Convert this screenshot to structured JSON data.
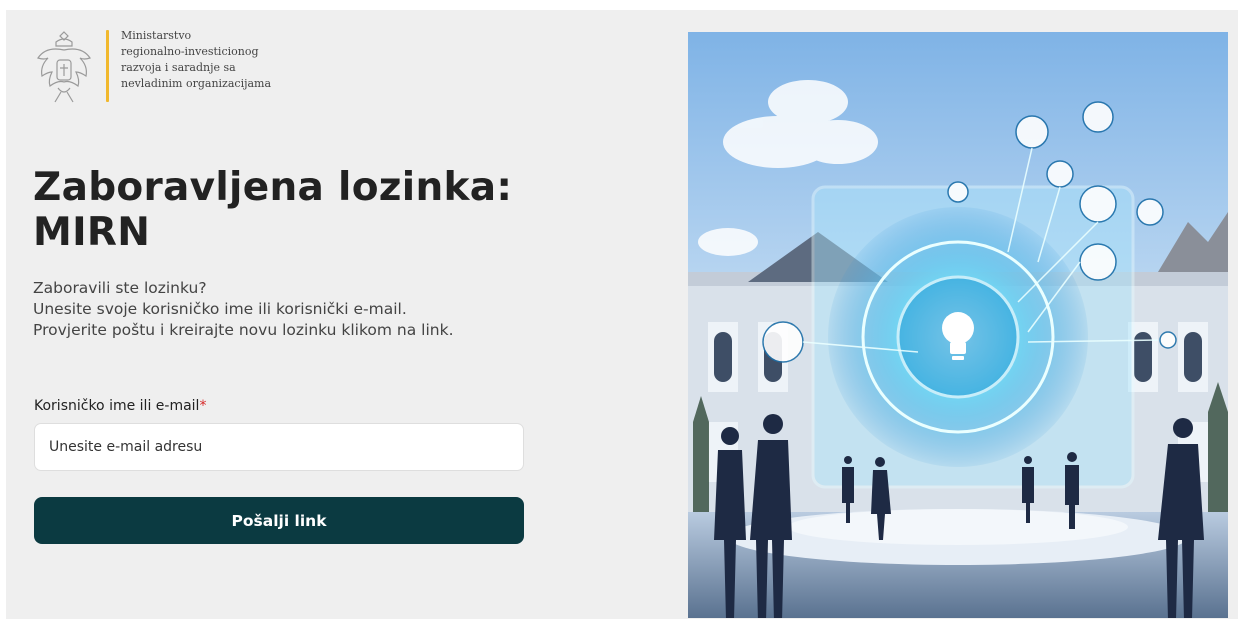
{
  "brand": {
    "logo_icon": "montenegro-coat-of-arms-icon",
    "name_lines": [
      "Ministarstvo",
      "regionalno-investicionog",
      "razvoja i saradnje sa",
      "nevladinim organizacijama"
    ],
    "accent_color": "#f1b82d"
  },
  "page": {
    "title_line1": "Zaboravljena lozinka:",
    "title_line2": "MIRN",
    "intro_line1": "Zaboravili ste lozinku?",
    "intro_line2": "Unesite svoje korisničko ime ili korisnički e-mail.",
    "intro_line3": "Provjerite poštu i kreirajte novu lozinku klikom na link."
  },
  "form": {
    "field_label": "Korisničko ime ili e-mail",
    "required_marker": "*",
    "email_placeholder": "Unesite e-mail adresu",
    "email_value": "",
    "submit_label": "Pošalji link",
    "button_color": "#0b3a41",
    "required_color": "#d62828"
  },
  "hero": {
    "image_icon": "digital-innovation-illustration",
    "central_icon": "lightbulb-icon"
  }
}
